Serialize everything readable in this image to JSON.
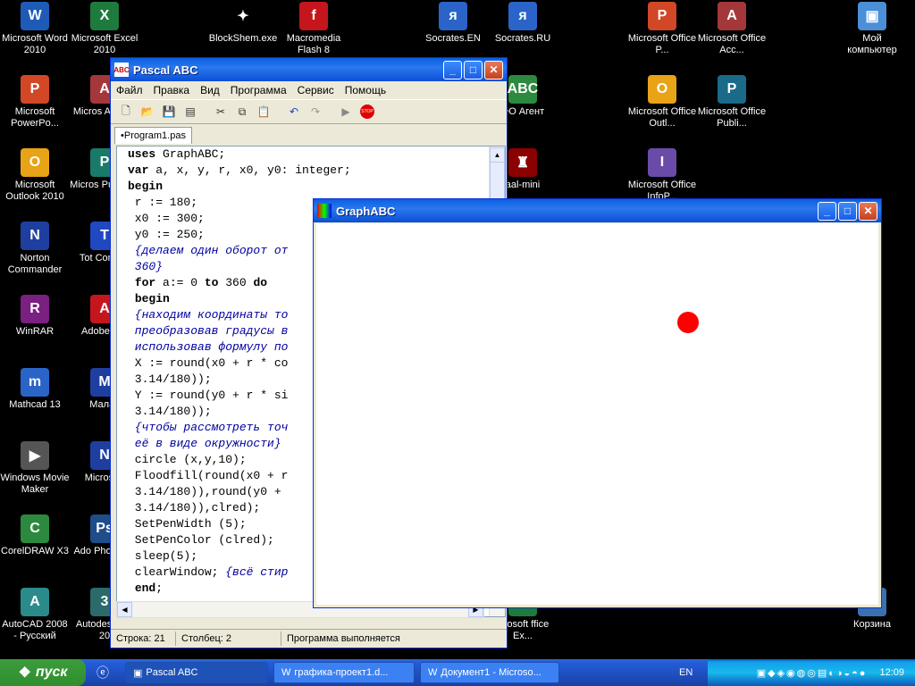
{
  "desktop": {
    "icons": [
      {
        "label": "Microsoft Word 2010",
        "glyph": "W",
        "color": "#1e5bb8"
      },
      {
        "label": "Microsoft Excel 2010",
        "glyph": "X",
        "color": "#1f7a3d"
      },
      {
        "label": "BlockShem.exe",
        "glyph": "✦",
        "color": "#000000"
      },
      {
        "label": "Macromedia Flash 8",
        "glyph": "f",
        "color": "#c4161c"
      },
      {
        "label": "Socrates.EN",
        "glyph": "я",
        "color": "#2a64c8"
      },
      {
        "label": "Socrates.RU",
        "glyph": "я",
        "color": "#2a64c8"
      },
      {
        "label": "Microsoft Office P...",
        "glyph": "P",
        "color": "#d24726"
      },
      {
        "label": "Microsoft Office Acc...",
        "glyph": "A",
        "color": "#a4373a"
      },
      {
        "label": "Мой компьютер",
        "glyph": "▣",
        "color": "#4a8fd8"
      },
      {
        "label": "Microsoft PowerPo...",
        "glyph": "P",
        "color": "#d24726"
      },
      {
        "label": "Micros Access",
        "glyph": "A",
        "color": "#a4373a"
      },
      {
        "label": "ФО Агент",
        "glyph": "ABC",
        "color": "#2b8a3e"
      },
      {
        "label": "Microsoft Office Outl...",
        "glyph": "O",
        "color": "#e8a317"
      },
      {
        "label": "Microsoft Office Publi...",
        "glyph": "P",
        "color": "#1a6a8a"
      },
      {
        "label": "Microsoft Outlook 2010",
        "glyph": "O",
        "color": "#e8a317"
      },
      {
        "label": "Micros Publishe",
        "glyph": "P",
        "color": "#1a7a6a"
      },
      {
        "label": "aal-mini",
        "glyph": "♜",
        "color": "#8b0000"
      },
      {
        "label": "Microsoft Office InfoP...",
        "glyph": "I",
        "color": "#6a4ba8"
      },
      {
        "label": "Norton Commander",
        "glyph": "N",
        "color": "#1f3fa0"
      },
      {
        "label": "Tot Comma",
        "glyph": "T",
        "color": "#2048c0"
      },
      {
        "label": "WinRAR",
        "glyph": "R",
        "color": "#7a2080"
      },
      {
        "label": "Adobe R 9",
        "glyph": "A",
        "color": "#c4161c"
      },
      {
        "label": "Mathcad 13",
        "glyph": "m",
        "color": "#2a64c8"
      },
      {
        "label": "Малах",
        "glyph": "M",
        "color": "#1f3fa0"
      },
      {
        "label": "Windows Movie Maker",
        "glyph": "▶",
        "color": "#555555"
      },
      {
        "label": "Microsoft",
        "glyph": "N",
        "color": "#1f3fa0"
      },
      {
        "label": "CorelDRAW X3",
        "glyph": "C",
        "color": "#2b8a3e"
      },
      {
        "label": "Ado Photoshe",
        "glyph": "Ps",
        "color": "#1f4d8a"
      },
      {
        "label": "AutoCAD 2008 - Русский",
        "glyph": "A",
        "color": "#2b8a8a"
      },
      {
        "label": "Autodes Max 20",
        "glyph": "3",
        "color": "#2b6a6a"
      },
      {
        "label": "icrosoft ffice Ex...",
        "glyph": "X",
        "color": "#1f7a3d"
      },
      {
        "label": "Корзина",
        "glyph": "♻",
        "color": "#3a70b0"
      }
    ]
  },
  "pascal_window": {
    "title": "Pascal ABC",
    "menu": [
      "Файл",
      "Правка",
      "Вид",
      "Программа",
      "Сервис",
      "Помощь"
    ],
    "toolbar_icons": [
      "new-file-icon",
      "open-folder-icon",
      "save-icon",
      "save-all-icon",
      "cut-icon",
      "copy-icon",
      "paste-icon",
      "undo-icon",
      "redo-icon",
      "run-icon",
      "stop-icon"
    ],
    "tab_label": "•Program1.pas",
    "code_lines": [
      [
        {
          "t": "uses",
          "c": "kw"
        },
        {
          "t": " GraphABC;",
          "c": ""
        }
      ],
      [
        {
          "t": "var",
          "c": "kw"
        },
        {
          "t": " a, x, y, r, x0, y0: integer;",
          "c": ""
        }
      ],
      [
        {
          "t": "begin",
          "c": "kw"
        }
      ],
      [
        {
          "t": " r := 180;",
          "c": ""
        }
      ],
      [
        {
          "t": " x0 := 300;",
          "c": ""
        }
      ],
      [
        {
          "t": " y0 := 250;",
          "c": ""
        }
      ],
      [
        {
          "t": " {делаем один оборот от",
          "c": "cm"
        }
      ],
      [
        {
          "t": " 360}",
          "c": "cm"
        }
      ],
      [
        {
          "t": " ",
          "c": ""
        },
        {
          "t": "for",
          "c": "kw"
        },
        {
          "t": " a:= 0 ",
          "c": ""
        },
        {
          "t": "to",
          "c": "kw"
        },
        {
          "t": " 360 ",
          "c": ""
        },
        {
          "t": "do",
          "c": "kw"
        }
      ],
      [
        {
          "t": " ",
          "c": ""
        },
        {
          "t": "begin",
          "c": "kw"
        }
      ],
      [
        {
          "t": " {находим координаты то",
          "c": "cm"
        }
      ],
      [
        {
          "t": " преобразовав градусы в",
          "c": "cm"
        }
      ],
      [
        {
          "t": " использовав формулу по",
          "c": "cm"
        }
      ],
      [
        {
          "t": " X := round(x0 + r * co",
          "c": ""
        }
      ],
      [
        {
          "t": " 3.14/180));",
          "c": ""
        }
      ],
      [
        {
          "t": " Y := round(y0 + r * si",
          "c": ""
        }
      ],
      [
        {
          "t": " 3.14/180));",
          "c": ""
        }
      ],
      [
        {
          "t": " {чтобы рассмотреть точ",
          "c": "cm"
        }
      ],
      [
        {
          "t": " её в виде окружности}",
          "c": "cm"
        }
      ],
      [
        {
          "t": " circle (x,y,10);",
          "c": ""
        }
      ],
      [
        {
          "t": " Floodfill(round(x0 + r",
          "c": ""
        }
      ],
      [
        {
          "t": " 3.14/180)),round(y0 +",
          "c": ""
        }
      ],
      [
        {
          "t": " 3.14/180)),clred);",
          "c": ""
        }
      ],
      [
        {
          "t": " SetPenWidth (5);",
          "c": ""
        }
      ],
      [
        {
          "t": " SetPenColor (clred);",
          "c": ""
        }
      ],
      [
        {
          "t": " sleep(5);",
          "c": ""
        }
      ],
      [
        {
          "t": " clearWindow; ",
          "c": ""
        },
        {
          "t": "{всё стир",
          "c": "cm"
        }
      ],
      [
        {
          "t": " ",
          "c": ""
        },
        {
          "t": "end",
          "c": "kw"
        },
        {
          "t": ";",
          "c": ""
        }
      ]
    ],
    "status": {
      "row": "Строка: 21",
      "col": "Столбец: 2",
      "state": "Программа выполняется"
    }
  },
  "graph_window": {
    "title": "GraphABC",
    "dot_color": "#ff0000"
  },
  "taskbar": {
    "start_label": "пуск",
    "buttons": [
      "Pascal ABC",
      "графика-проект1.d...",
      "Документ1 - Microso..."
    ],
    "lang": "EN",
    "clock": "12:09"
  }
}
